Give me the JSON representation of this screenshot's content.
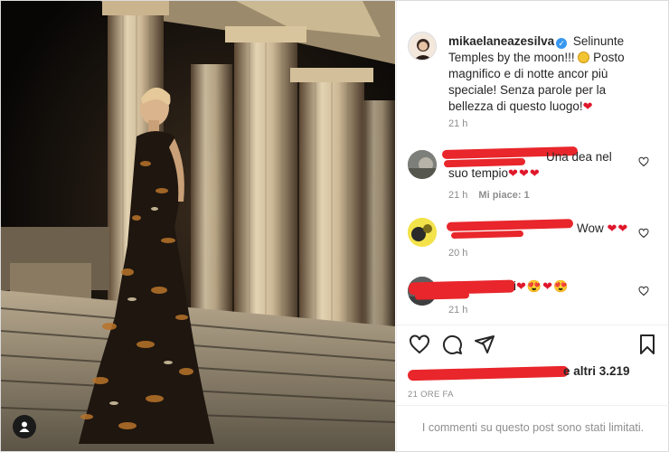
{
  "post": {
    "author": "mikaelaneazesilva",
    "caption_part1": "Selinunte Temples by the moon!!!",
    "caption_part2": "Posto magnifico e di notte ancor più speciale! Senza parole per la bellezza di questo luogo!",
    "caption_emoji_heart": "❤",
    "caption_time": "21 h"
  },
  "comments": [
    {
      "text": "Una dea nel suo tempio",
      "hearts": "❤❤❤",
      "time": "21 h",
      "likes": "Mi piace: 1"
    },
    {
      "text": "Wow",
      "hearts": "❤❤",
      "time": "20 h"
    },
    {
      "text": "i",
      "hearts": "❤😍❤😍",
      "time": "21 h"
    }
  ],
  "likes_text": "e altri 3.219",
  "date_text": "21 ORE FA",
  "comments_limited": "I commenti su questo post sono stati limitati.",
  "icons": [
    "heart-icon",
    "comment-icon",
    "share-icon",
    "bookmark-icon",
    "user-tag-icon",
    "verified-badge-icon"
  ],
  "colors": {
    "link": "#3897f0",
    "redaction": "#e8262b",
    "muted": "#8e8e8e"
  }
}
